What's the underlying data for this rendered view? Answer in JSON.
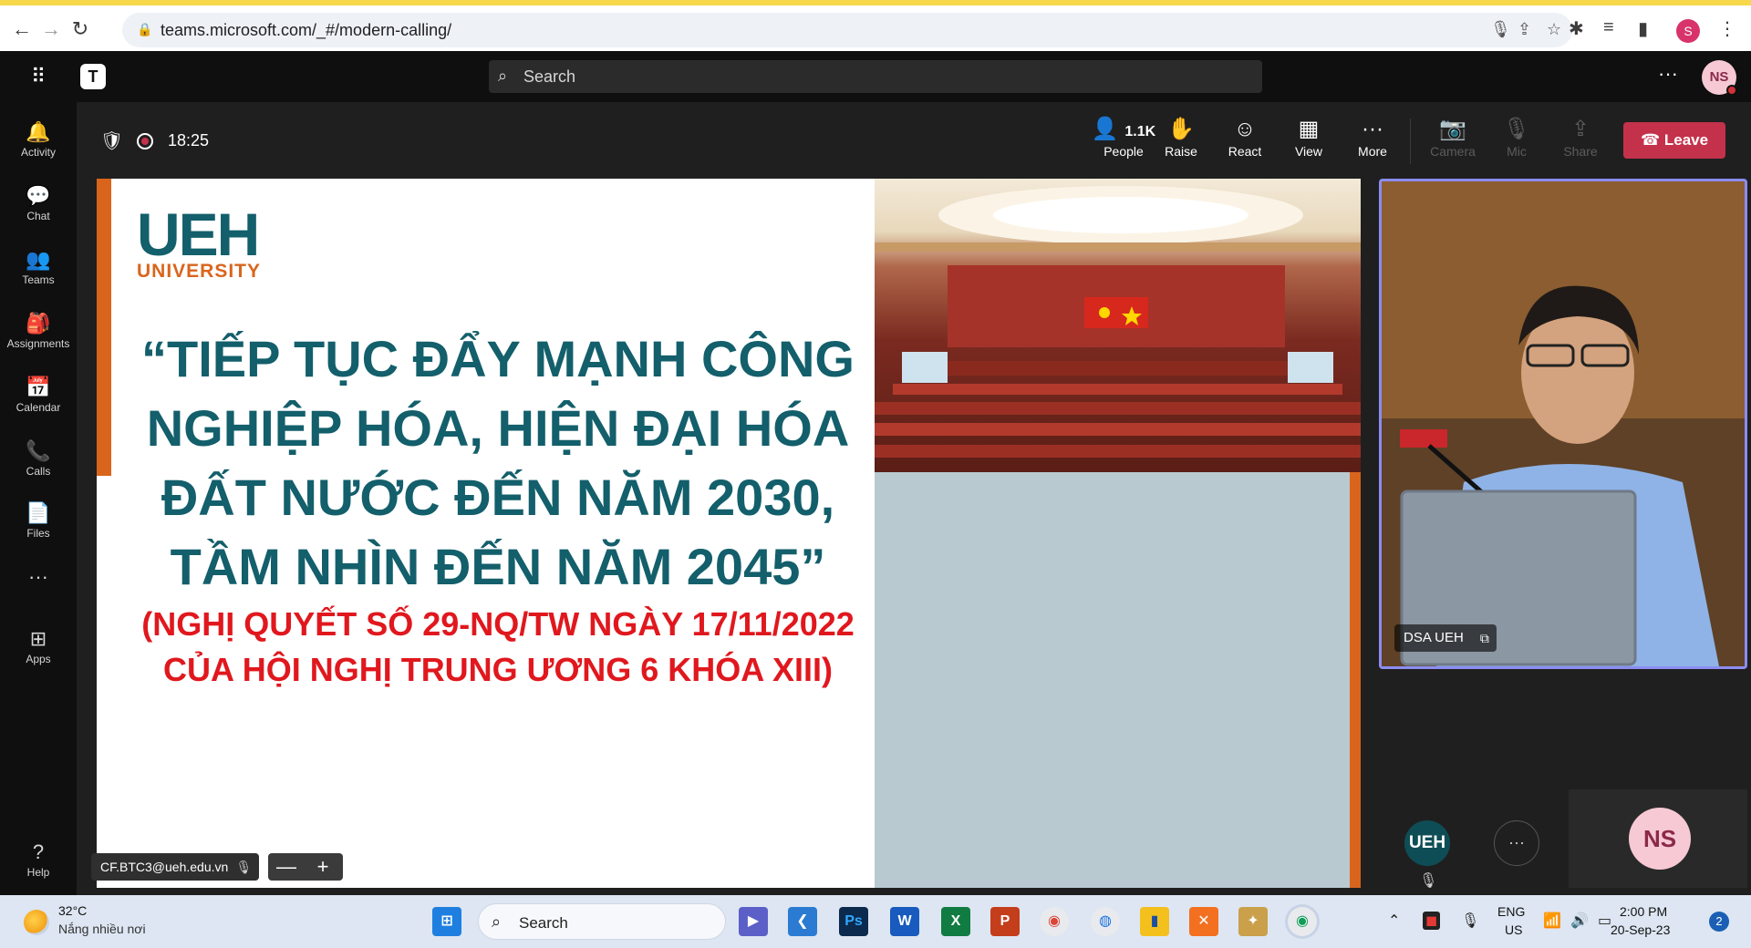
{
  "browser": {
    "back": "←",
    "forward": "→",
    "reload": "↻",
    "url": "teams.microsoft.com/_#/modern-calling/",
    "profile_initial": "S"
  },
  "teams_top": {
    "search_placeholder": "Search",
    "avatar_initials": "NS"
  },
  "rail": {
    "items": [
      {
        "label": "Activity",
        "icon": "bell-icon",
        "glyph": "🔔"
      },
      {
        "label": "Chat",
        "icon": "chat-icon",
        "glyph": "💬"
      },
      {
        "label": "Teams",
        "icon": "teams-icon",
        "glyph": "👥"
      },
      {
        "label": "Assignments",
        "icon": "assignments-icon",
        "glyph": "🎒"
      },
      {
        "label": "Calendar",
        "icon": "calendar-icon",
        "glyph": "📅"
      },
      {
        "label": "Calls",
        "icon": "phone-icon",
        "glyph": "📞"
      },
      {
        "label": "Files",
        "icon": "file-icon",
        "glyph": "📄"
      },
      {
        "label": "",
        "icon": "more-icon",
        "glyph": "···"
      },
      {
        "label": "Apps",
        "icon": "apps-icon",
        "glyph": "⊞"
      }
    ],
    "help": {
      "label": "Help",
      "glyph": "?"
    }
  },
  "meeting": {
    "timer": "18:25",
    "people_count": "1.1K",
    "tools": {
      "people": "People",
      "raise": "Raise",
      "react": "React",
      "view": "View",
      "more": "More",
      "camera": "Camera",
      "mic": "Mic",
      "share": "Share"
    },
    "leave": "Leave"
  },
  "slide": {
    "logo_main": "UEH",
    "logo_sub": "UNIVERSITY",
    "title_lines": [
      "“TIẾP TỤC ĐẨY MẠNH CÔNG",
      "NGHIỆP HÓA, HIỆN ĐẠI HÓA",
      "ĐẤT NƯỚC ĐẾN NĂM 2030,",
      "TẦM NHÌN ĐẾN NĂM 2045”"
    ],
    "subtitle_lines": [
      "(NGHỊ QUYẾT SỐ 29-NQ/TW NGÀY 17/11/2022",
      "CỦA HỘI NGHỊ TRUNG ƯƠNG 6 KHÓA XIII)"
    ]
  },
  "presenter": {
    "email": "CF.BTC3@ueh.edu.vn",
    "zoom_out": "—",
    "zoom_in": "+"
  },
  "video": {
    "name": "DSA UEH"
  },
  "participants": {
    "ueh_initials": "UEH",
    "more": "···",
    "ns_initials": "NS"
  },
  "taskbar": {
    "temp": "32°C",
    "weather": "Nắng nhiều nơi",
    "search": "Search",
    "lang_line1": "ENG",
    "lang_line2": "US",
    "time": "2:00 PM",
    "date": "20-Sep-23",
    "notifications": "2"
  }
}
